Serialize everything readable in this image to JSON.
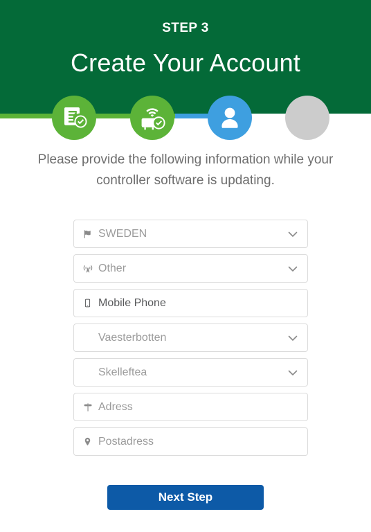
{
  "header": {
    "step_label": "STEP 3",
    "title": "Create Your Account",
    "bg_color": "#046A38"
  },
  "stepper": {
    "steps": [
      {
        "id": "step-1",
        "icon": "document-check-icon",
        "state": "complete",
        "color": "#5cb338"
      },
      {
        "id": "step-2",
        "icon": "router-check-icon",
        "state": "complete",
        "color": "#5cb338"
      },
      {
        "id": "step-3",
        "icon": "user-icon",
        "state": "current",
        "color": "#3e9fe0"
      },
      {
        "id": "step-4",
        "icon": "empty-icon",
        "state": "upcoming",
        "color": "#cccccc"
      }
    ],
    "track_colors": {
      "complete": "#5cb338",
      "current": "#3e9fe0",
      "upcoming": "#ffffff"
    }
  },
  "instruction": {
    "text": "Please provide the following information while your controller software is updating."
  },
  "form": {
    "fields": [
      {
        "name": "country-select",
        "icon": "flag-icon",
        "value": "SWEDEN",
        "placeholder": "SWEDEN",
        "type": "select",
        "filled": false,
        "has_icon": true
      },
      {
        "name": "provider-select",
        "icon": "broadcast-tower-icon",
        "value": "Other",
        "placeholder": "Other",
        "type": "select",
        "filled": false,
        "has_icon": true
      },
      {
        "name": "mobile-phone-input",
        "icon": "mobile-phone-icon",
        "value": "Mobile Phone",
        "placeholder": "Mobile Phone",
        "type": "text",
        "filled": true,
        "has_icon": true
      },
      {
        "name": "region-select",
        "icon": "",
        "value": "Vaesterbotten",
        "placeholder": "Vaesterbotten",
        "type": "select",
        "filled": false,
        "has_icon": false
      },
      {
        "name": "city-select",
        "icon": "",
        "value": "Skelleftea",
        "placeholder": "Skelleftea",
        "type": "select",
        "filled": false,
        "has_icon": false
      },
      {
        "name": "address-input",
        "icon": "street-sign-icon",
        "value": "Adress",
        "placeholder": "Adress",
        "type": "text",
        "filled": false,
        "has_icon": true
      },
      {
        "name": "postal-address-input",
        "icon": "map-marker-icon",
        "value": "Postadress",
        "placeholder": "Postadress",
        "type": "text",
        "filled": false,
        "has_icon": true
      }
    ]
  },
  "footer": {
    "next_button_label": "Next Step",
    "next_button_color": "#0d5aa7"
  }
}
